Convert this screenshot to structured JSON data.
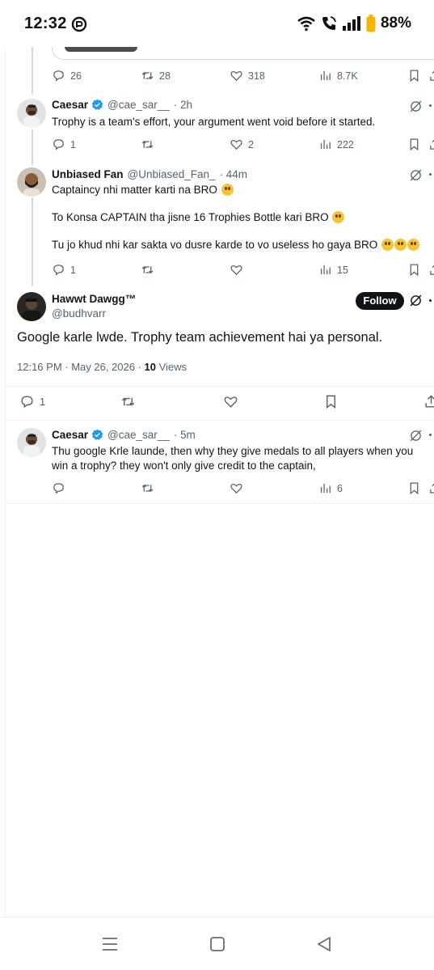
{
  "status_bar": {
    "time": "12:32",
    "battery": "88%"
  },
  "top_card_actions": {
    "replies": "26",
    "reposts": "28",
    "likes": "318",
    "views": "8.7K"
  },
  "tweets": [
    {
      "name": "Caesar",
      "handle": "@cae_sar__",
      "time": "· 2h",
      "verified": true,
      "lines": [
        "Trophy is a team's effort, your argument went void before it started."
      ],
      "replies": "1",
      "reposts": "",
      "likes": "2",
      "views": "222"
    },
    {
      "name": "Unbiased Fan",
      "handle": "@Unbiased_Fan_",
      "time": "· 44m",
      "verified": false,
      "lines": [
        "Captaincy nhi matter karti na BRO",
        "To Konsa CAPTAIN tha jisne 16 Trophies Bottle kari BRO",
        "Tu jo khud nhi kar sakta vo dusre karde to vo useless ho gaya BRO"
      ],
      "replies": "1",
      "reposts": "",
      "likes": "",
      "views": "15"
    }
  ],
  "main_tweet": {
    "name": "Hawwt Dawgg™",
    "handle": "@budhvarr",
    "follow_label": "Follow",
    "text": "Google karle lwde. Trophy team achievement hai ya personal.",
    "timestamp": "12:16 PM · May 26, 2026 · ",
    "views_count": "10",
    "views_label": " Views",
    "replies": "1"
  },
  "reply": {
    "name": "Caesar",
    "handle": "@cae_sar__",
    "time": "· 5m",
    "verified": true,
    "text": "Thu google Krle launde, then why they give medals to all players when you win a trophy? they won't only give credit to the captain,",
    "replies": "",
    "reposts": "",
    "likes": "",
    "views": "6"
  },
  "colors": {
    "accent": "#1d9bf0",
    "text": "#0f1419",
    "secondary": "#536471",
    "battery": "#f5b400"
  }
}
